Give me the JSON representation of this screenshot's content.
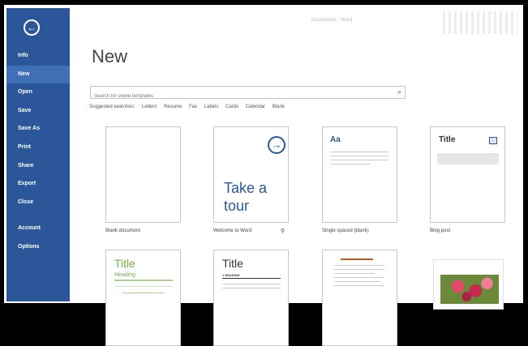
{
  "window": {
    "title": "Document1 - Word"
  },
  "sidebar": {
    "back_label": "←",
    "items": [
      {
        "label": "Info"
      },
      {
        "label": "New",
        "active": true
      },
      {
        "label": "Open"
      },
      {
        "label": "Save"
      },
      {
        "label": "Save As"
      },
      {
        "label": "Print"
      },
      {
        "label": "Share"
      },
      {
        "label": "Export"
      },
      {
        "label": "Close"
      },
      {
        "label": "Account"
      },
      {
        "label": "Options"
      }
    ],
    "color": "#2b579a"
  },
  "main": {
    "title": "New",
    "search": {
      "placeholder": "Search for online templates",
      "icon": "search-icon"
    },
    "suggested": {
      "label": "Suggested searches:",
      "items": [
        "Letters",
        "Resume",
        "Fax",
        "Labels",
        "Cards",
        "Calendar",
        "Blank"
      ]
    },
    "templates": [
      {
        "label": "Blank document"
      },
      {
        "label": "Welcome to Word",
        "pin": "⚲",
        "tour_text_1": "Take a",
        "tour_text_2": "tour",
        "icon": "arrow-right-circle-icon"
      },
      {
        "label": "Single spaced (blank)",
        "preview_text": "Aa"
      },
      {
        "label": "Blog post",
        "preview_text": "Title",
        "icon": "image-icon"
      },
      {
        "label": "",
        "preview_title": "Title",
        "preview_heading": "Heading"
      },
      {
        "label": "",
        "preview_title": "Title",
        "preview_heading": "1  HEADING"
      },
      {
        "label": ""
      },
      {
        "label": ""
      }
    ]
  }
}
